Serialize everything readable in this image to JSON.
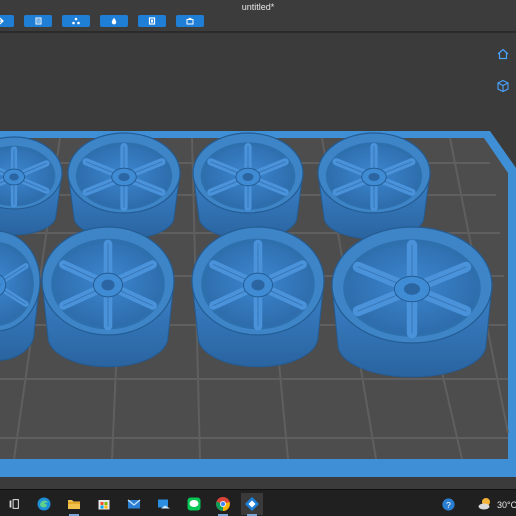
{
  "window": {
    "title": "untitled*"
  },
  "toolbar": {
    "buttons": [
      {
        "icon": "arrow-icon"
      },
      {
        "icon": "document-icon"
      },
      {
        "icon": "nodes-icon"
      },
      {
        "icon": "drop-icon"
      },
      {
        "icon": "square-icon"
      },
      {
        "icon": "briefcase-icon"
      }
    ],
    "accent": "#1f7fd6"
  },
  "viewport": {
    "side_icons": [
      "home-icon",
      "cube-view-icon"
    ],
    "bed_color": "#4d4d4d",
    "bed_border_color": "#3f8fd6",
    "model_color": "#3d85c6"
  },
  "taskbar": {
    "apps": [
      "task-view-icon",
      "edge-icon",
      "file-explorer-icon",
      "store-icon",
      "mail-icon",
      "photos-icon",
      "line-icon",
      "chrome-icon",
      "slicer-app-icon"
    ],
    "tray": {
      "help_icon": "help-icon",
      "weather_icon": "weather-icon",
      "temperature": "30°C"
    }
  }
}
